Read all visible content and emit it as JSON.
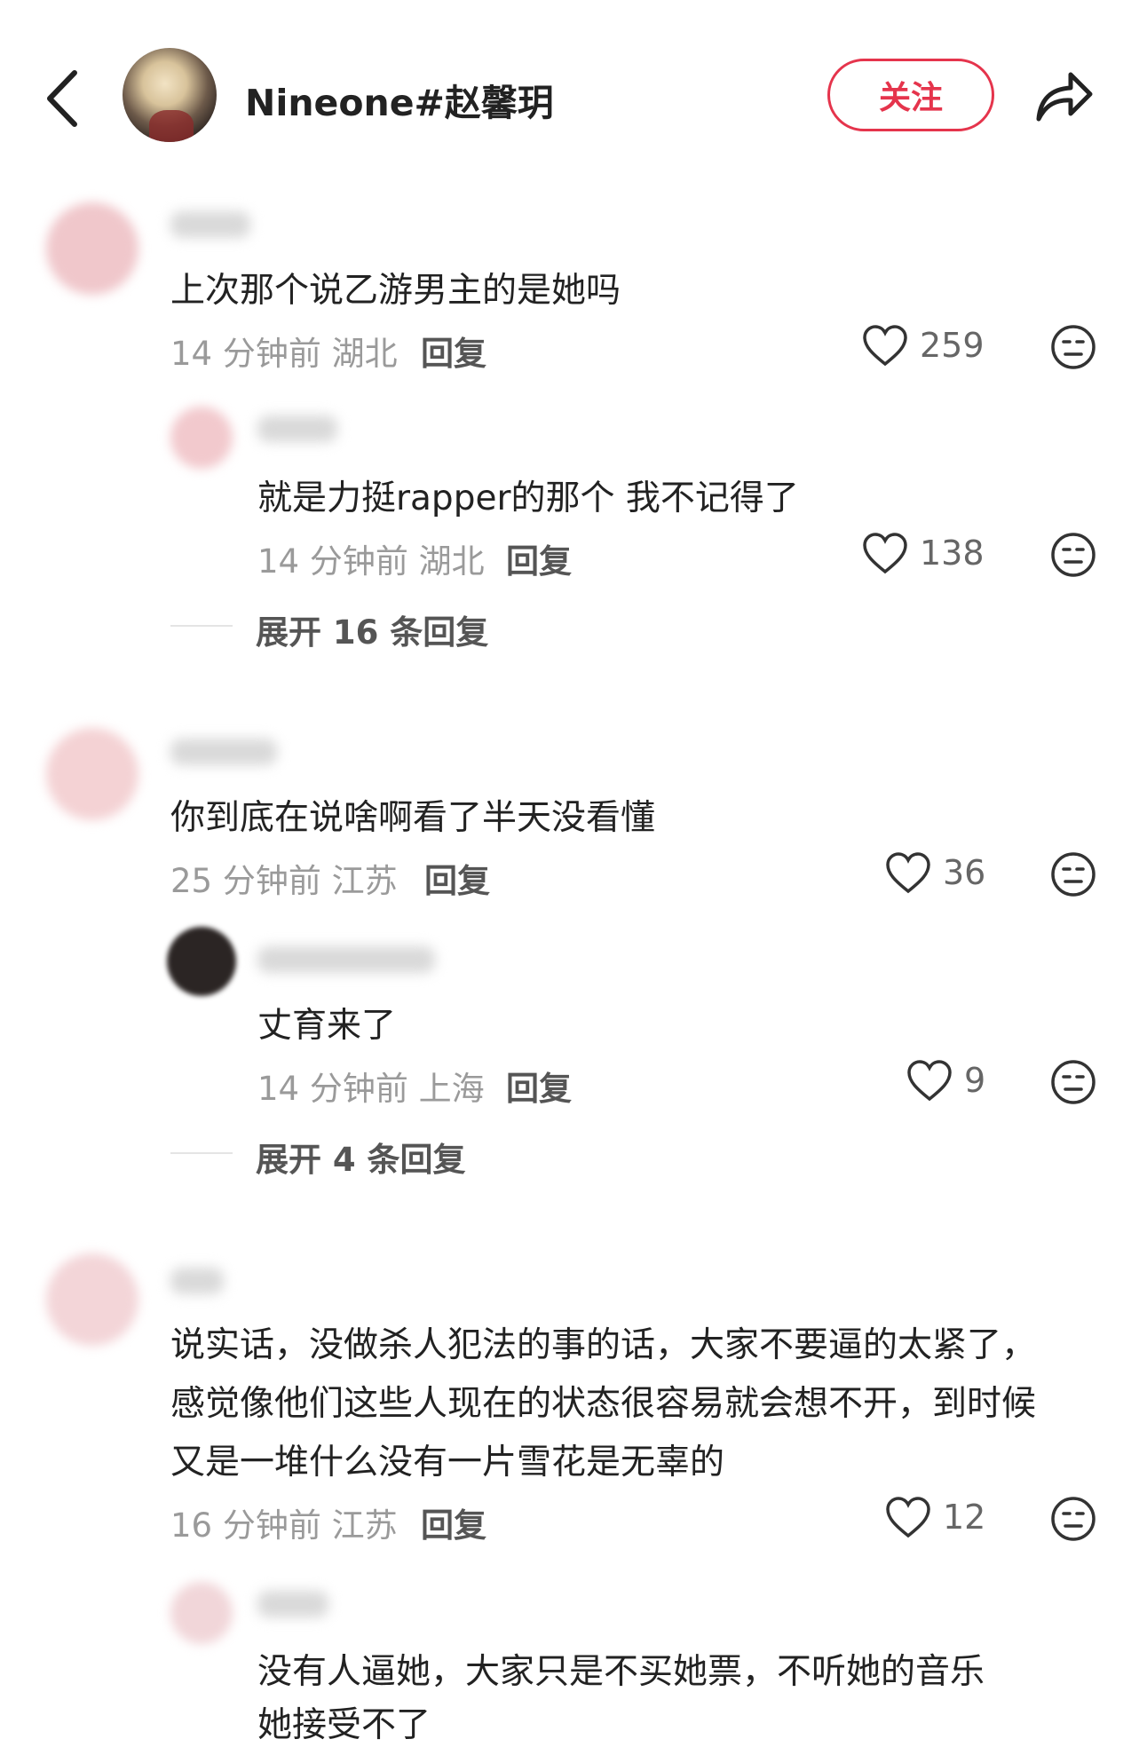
{
  "header": {
    "username": "Nineone#赵馨玥",
    "follow_label": "关注",
    "back_icon": "chevron-left-icon",
    "share_icon": "share-arrow-icon"
  },
  "colors": {
    "accent": "#e5344c",
    "meta_text": "#9a9a9a"
  },
  "comments": [
    {
      "text": "上次那个说乙游男主的是她吗",
      "time": "14 分钟前",
      "location": "湖北",
      "reply_label": "回复",
      "likes": "259",
      "reply": {
        "text": "就是力挺rapper的那个 我不记得了",
        "time": "14 分钟前",
        "location": "湖北",
        "reply_label": "回复",
        "likes": "138"
      },
      "expand_label": "展开 16 条回复"
    },
    {
      "text": "你到底在说啥啊看了半天没看懂",
      "time": "25 分钟前",
      "location": "江苏",
      "reply_label": "回复",
      "likes": "36",
      "reply": {
        "text": "丈育来了",
        "time": "14 分钟前",
        "location": "上海",
        "reply_label": "回复",
        "likes": "9"
      },
      "expand_label": "展开 4 条回复"
    },
    {
      "text_lines": [
        "说实话，没做杀人犯法的事的话，大家不要逼的太紧了，",
        "感觉像他们这些人现在的状态很容易就会想不开，到时候",
        "又是一堆什么没有一片雪花是无辜的"
      ],
      "time": "16 分钟前",
      "location": "江苏",
      "reply_label": "回复",
      "likes": "12",
      "reply": {
        "text_lines": [
          "没有人逼她，大家只是不买她票，不听她的音乐",
          "她接受不了"
        ]
      }
    }
  ]
}
